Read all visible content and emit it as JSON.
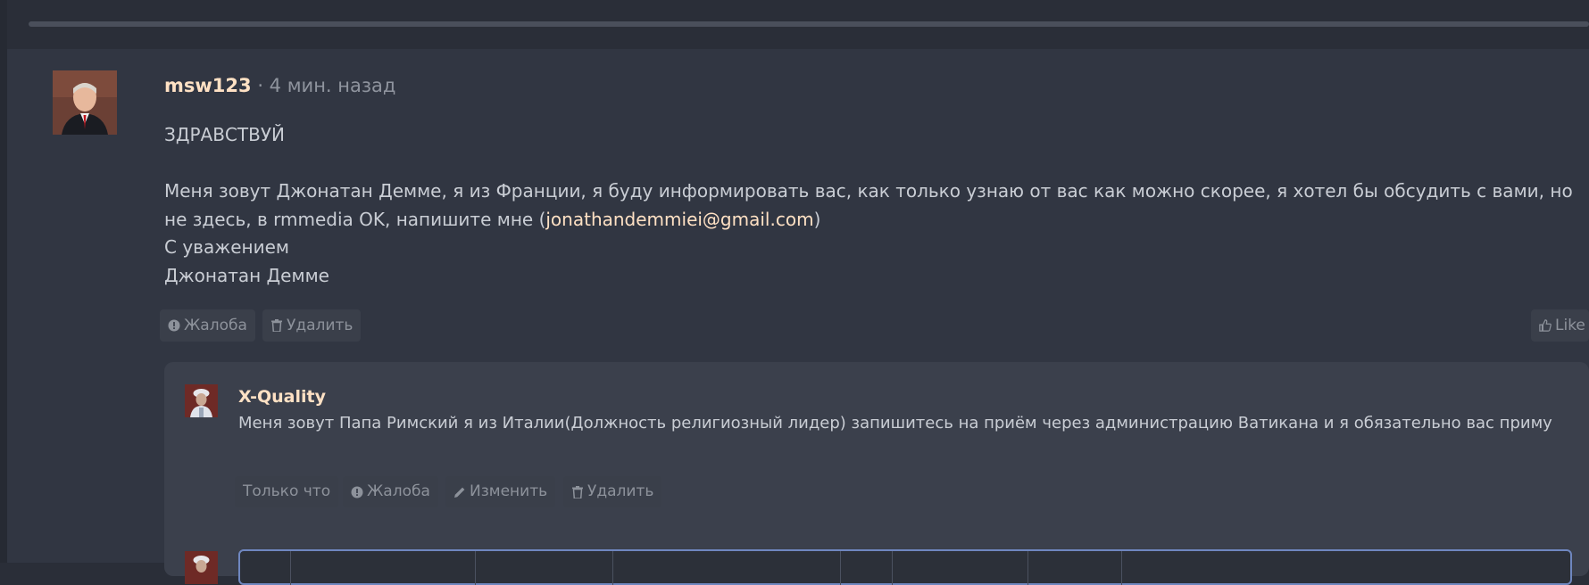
{
  "post": {
    "username": "msw123",
    "time": "4 мин. назад",
    "message": {
      "greeting": "ЗДРАВСТВУЙ",
      "body_before_link": "Меня зовут Джонатан Демме, я из Франции, я буду информировать вас, как только узнаю от вас как можно скорее, я хотел бы обсудить с вами, но не здесь, в rmmedia OK, напишите мне (",
      "link": "jonathandemmiei@gmail.com",
      "body_after_link": ")",
      "regards": "С уважением",
      "signature": "Джонатан Демме"
    },
    "actions": {
      "report": "Жалоба",
      "delete": "Удалить",
      "like": "Like"
    }
  },
  "reply": {
    "author": "X-Quality",
    "text": "Меня зовут Папа Римский я из Италии(Должность религиозный лидер) запишитесь на приём через администрацию Ватикана и я обязательно вас приму",
    "actions": {
      "time": "Только что",
      "report": "Жалоба",
      "edit": "Изменить",
      "delete": "Удалить"
    }
  },
  "colors": {
    "page_bg": "#2a2e38",
    "post_bg": "#313642",
    "card_bg": "#3b404c",
    "username": "#ffe1c4",
    "text": "#c9cdd4",
    "muted": "#8d929b",
    "button_bg": "#3a3f4a",
    "composer_border": "#6f87c0"
  },
  "icons": {
    "report": "exclamation-circle-icon",
    "delete": "trash-icon",
    "like": "thumbs-up-icon",
    "edit": "pencil-icon"
  }
}
